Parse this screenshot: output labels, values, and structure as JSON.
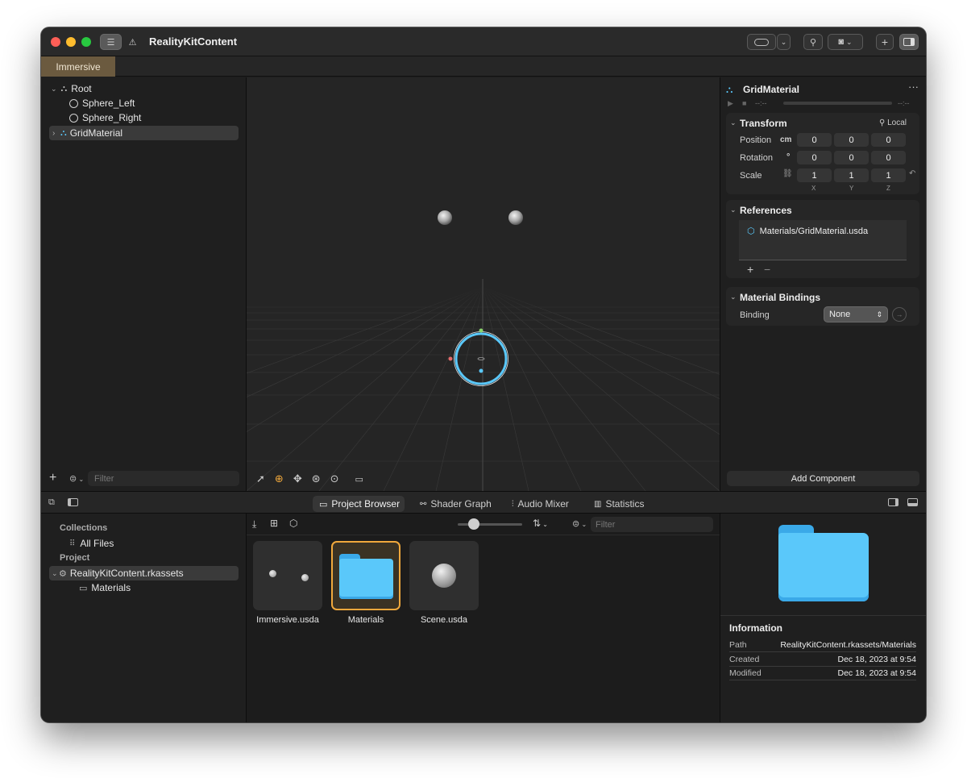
{
  "window": {
    "title": "RealityKitContent"
  },
  "tabs": [
    {
      "label": "Immersive"
    }
  ],
  "hierarchy": {
    "items": [
      {
        "label": "Root"
      },
      {
        "label": "Sphere_Left"
      },
      {
        "label": "Sphere_Right"
      },
      {
        "label": "GridMaterial"
      }
    ],
    "filter_placeholder": "Filter"
  },
  "inspector": {
    "entity_name": "GridMaterial",
    "timeline": {
      "start": "--:--",
      "end": "--:--"
    },
    "transform": {
      "title": "Transform",
      "space_label": "Local",
      "rows": [
        {
          "label": "Position",
          "unit": "cm",
          "x": "0",
          "y": "0",
          "z": "0"
        },
        {
          "label": "Rotation",
          "unit": "°",
          "x": "0",
          "y": "0",
          "z": "0"
        },
        {
          "label": "Scale",
          "unit": "",
          "x": "1",
          "y": "1",
          "z": "1"
        }
      ],
      "axes": [
        "X",
        "Y",
        "Z"
      ]
    },
    "references": {
      "title": "References",
      "items": [
        "Materials/GridMaterial.usda"
      ]
    },
    "material_bindings": {
      "title": "Material Bindings",
      "binding_label": "Binding",
      "binding_value": "None"
    },
    "add_component_label": "Add Component"
  },
  "bottom_tabs": [
    {
      "label": "Project Browser",
      "icon": "folder-icon"
    },
    {
      "label": "Shader Graph",
      "icon": "nodes-icon"
    },
    {
      "label": "Audio Mixer",
      "icon": "sliders-icon"
    },
    {
      "label": "Statistics",
      "icon": "bars-icon"
    }
  ],
  "browser_sidebar": {
    "collections_header": "Collections",
    "all_files": "All Files",
    "project_header": "Project",
    "project_root": "RealityKitContent.rkassets",
    "folder": "Materials"
  },
  "browser": {
    "filter_placeholder": "Filter",
    "assets": [
      {
        "label": "Immersive.usda"
      },
      {
        "label": "Materials"
      },
      {
        "label": "Scene.usda"
      }
    ],
    "zoom": 0.15
  },
  "info": {
    "title": "Information",
    "rows": [
      {
        "key": "Path",
        "value": "RealityKitContent.rkassets/Materials"
      },
      {
        "key": "Created",
        "value": "Dec 18, 2023 at 9:54"
      },
      {
        "key": "Modified",
        "value": "Dec 18, 2023 at 9:54"
      }
    ]
  },
  "colors": {
    "accent_blue": "#5ac8fa",
    "selection_orange": "#f0a83c",
    "tab_active": "#6b5a3f"
  }
}
